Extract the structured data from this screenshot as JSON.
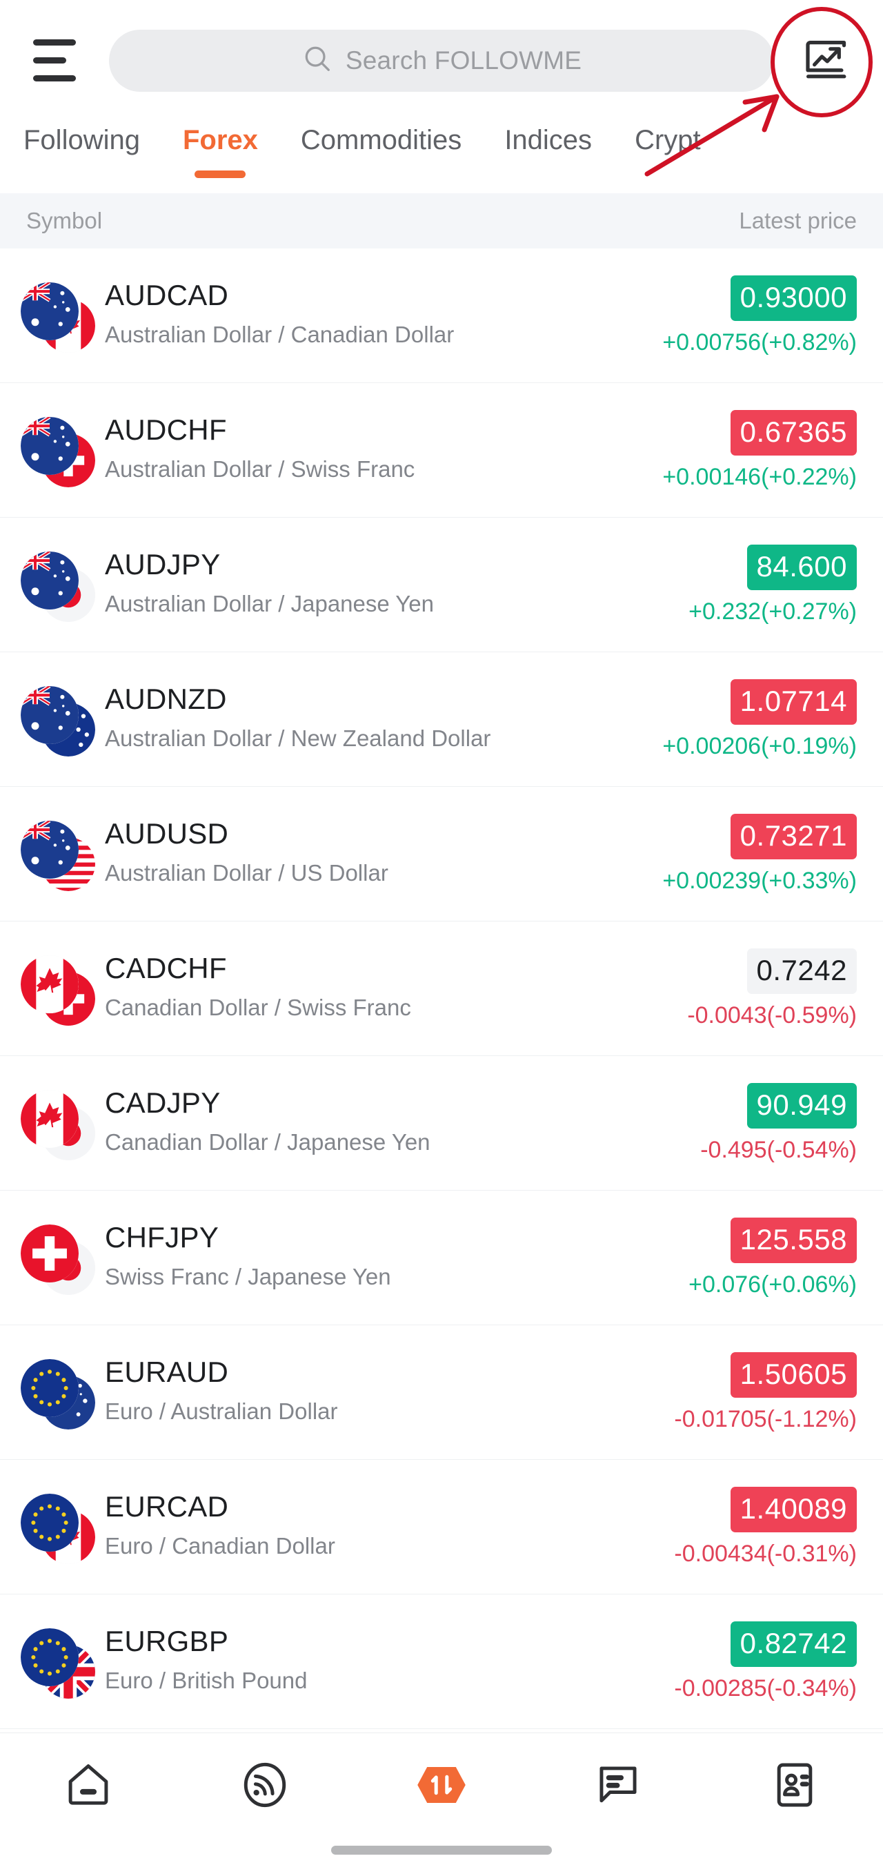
{
  "header": {
    "menu_icon": "hamburger-menu-icon",
    "search": {
      "icon": "search-icon",
      "placeholder": "Search FOLLOWME",
      "value": ""
    },
    "chart_button_icon": "chart-trending-up-icon"
  },
  "annotation": {
    "shape": "circle",
    "color": "#cf1225",
    "target": "chart-trending-up-icon"
  },
  "tabs": [
    {
      "label": "Following",
      "active": false
    },
    {
      "label": "Forex",
      "active": true
    },
    {
      "label": "Commodities",
      "active": false
    },
    {
      "label": "Indices",
      "active": false
    },
    {
      "label": "Crypt",
      "active": false
    }
  ],
  "column_header": {
    "symbol": "Symbol",
    "price": "Latest price"
  },
  "colors": {
    "accent": "#f26a35",
    "up": "#0fb787",
    "down": "#ef4256",
    "neutral": "#f2f3f5",
    "annotation": "#cf1225"
  },
  "instruments": [
    {
      "code": "AUDCAD",
      "name": "Australian Dollar / Canadian Dollar",
      "price": "0.93000",
      "price_state": "up",
      "change": "+0.00756(+0.82%)",
      "change_dir": "pos",
      "base": "au",
      "quote": "ca"
    },
    {
      "code": "AUDCHF",
      "name": "Australian Dollar / Swiss Franc",
      "price": "0.67365",
      "price_state": "down",
      "change": "+0.00146(+0.22%)",
      "change_dir": "pos",
      "base": "au",
      "quote": "ch"
    },
    {
      "code": "AUDJPY",
      "name": "Australian Dollar / Japanese Yen",
      "price": "84.600",
      "price_state": "up",
      "change": "+0.232(+0.27%)",
      "change_dir": "pos",
      "base": "au",
      "quote": "jp"
    },
    {
      "code": "AUDNZD",
      "name": "Australian Dollar / New Zealand Dollar",
      "price": "1.07714",
      "price_state": "down",
      "change": "+0.00206(+0.19%)",
      "change_dir": "pos",
      "base": "au",
      "quote": "nz"
    },
    {
      "code": "AUDUSD",
      "name": "Australian Dollar / US Dollar",
      "price": "0.73271",
      "price_state": "down",
      "change": "+0.00239(+0.33%)",
      "change_dir": "pos",
      "base": "au",
      "quote": "us"
    },
    {
      "code": "CADCHF",
      "name": "Canadian Dollar / Swiss Franc",
      "price": "0.7242",
      "price_state": "flat",
      "change": "-0.0043(-0.59%)",
      "change_dir": "neg",
      "base": "ca",
      "quote": "ch"
    },
    {
      "code": "CADJPY",
      "name": "Canadian Dollar / Japanese Yen",
      "price": "90.949",
      "price_state": "up",
      "change": "-0.495(-0.54%)",
      "change_dir": "neg",
      "base": "ca",
      "quote": "jp"
    },
    {
      "code": "CHFJPY",
      "name": "Swiss Franc / Japanese Yen",
      "price": "125.558",
      "price_state": "down",
      "change": "+0.076(+0.06%)",
      "change_dir": "pos",
      "base": "ch",
      "quote": "jp"
    },
    {
      "code": "EURAUD",
      "name": "Euro / Australian Dollar",
      "price": "1.50605",
      "price_state": "down",
      "change": "-0.01705(-1.12%)",
      "change_dir": "neg",
      "base": "eu",
      "quote": "au"
    },
    {
      "code": "EURCAD",
      "name": "Euro / Canadian Dollar",
      "price": "1.40089",
      "price_state": "down",
      "change": "-0.00434(-0.31%)",
      "change_dir": "neg",
      "base": "eu",
      "quote": "ca"
    },
    {
      "code": "EURGBP",
      "name": "Euro / British Pound",
      "price": "0.82742",
      "price_state": "up",
      "change": "-0.00285(-0.34%)",
      "change_dir": "neg",
      "base": "eu",
      "quote": "gb"
    }
  ],
  "bottom_nav": [
    {
      "icon": "home-icon",
      "active": false
    },
    {
      "icon": "signal-feed-icon",
      "active": false
    },
    {
      "icon": "trade-hexagon-icon",
      "active": true
    },
    {
      "icon": "chat-bubble-icon",
      "active": false
    },
    {
      "icon": "contact-card-icon",
      "active": false
    }
  ]
}
